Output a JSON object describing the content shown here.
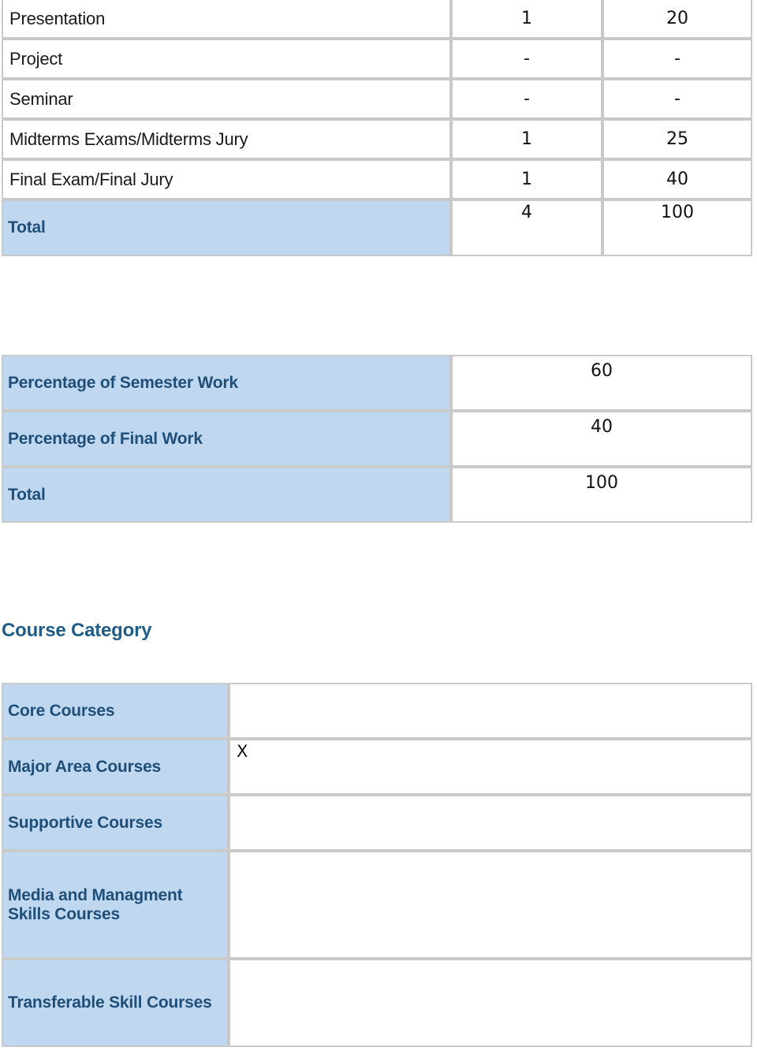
{
  "document": {
    "accent_blue_bg": "#bfd7ef",
    "accent_text": "#1f4e79",
    "heading_color": "#1f5c87",
    "border_color": "#c9c9c9"
  },
  "assessment_table": {
    "rows": [
      {
        "label": "Presentation",
        "count": "1",
        "contribution": "20",
        "highlight": false
      },
      {
        "label": "Project",
        "count": "-",
        "contribution": "-",
        "highlight": false
      },
      {
        "label": "Seminar",
        "count": "-",
        "contribution": "-",
        "highlight": false
      },
      {
        "label": "Midterms Exams/Midterms Jury",
        "count": "1",
        "contribution": "25",
        "highlight": false
      },
      {
        "label": "Final Exam/Final Jury",
        "count": "1",
        "contribution": "40",
        "highlight": false
      },
      {
        "label": "Total",
        "count": "4",
        "contribution": "100",
        "highlight": true
      }
    ]
  },
  "percentage_table": {
    "rows": [
      {
        "label": "Percentage of Semester Work",
        "value": "60"
      },
      {
        "label": "Percentage of Final Work",
        "value": "40"
      },
      {
        "label": "Total",
        "value": "100"
      }
    ]
  },
  "course_category": {
    "heading": "Course Category",
    "rows": [
      {
        "label": "Core Courses",
        "mark": ""
      },
      {
        "label": "Major Area Courses",
        "mark": "X"
      },
      {
        "label": "Supportive Courses",
        "mark": ""
      },
      {
        "label": "Media and Managment Skills Courses",
        "mark": ""
      },
      {
        "label": "Transferable Skill Courses",
        "mark": ""
      }
    ]
  }
}
